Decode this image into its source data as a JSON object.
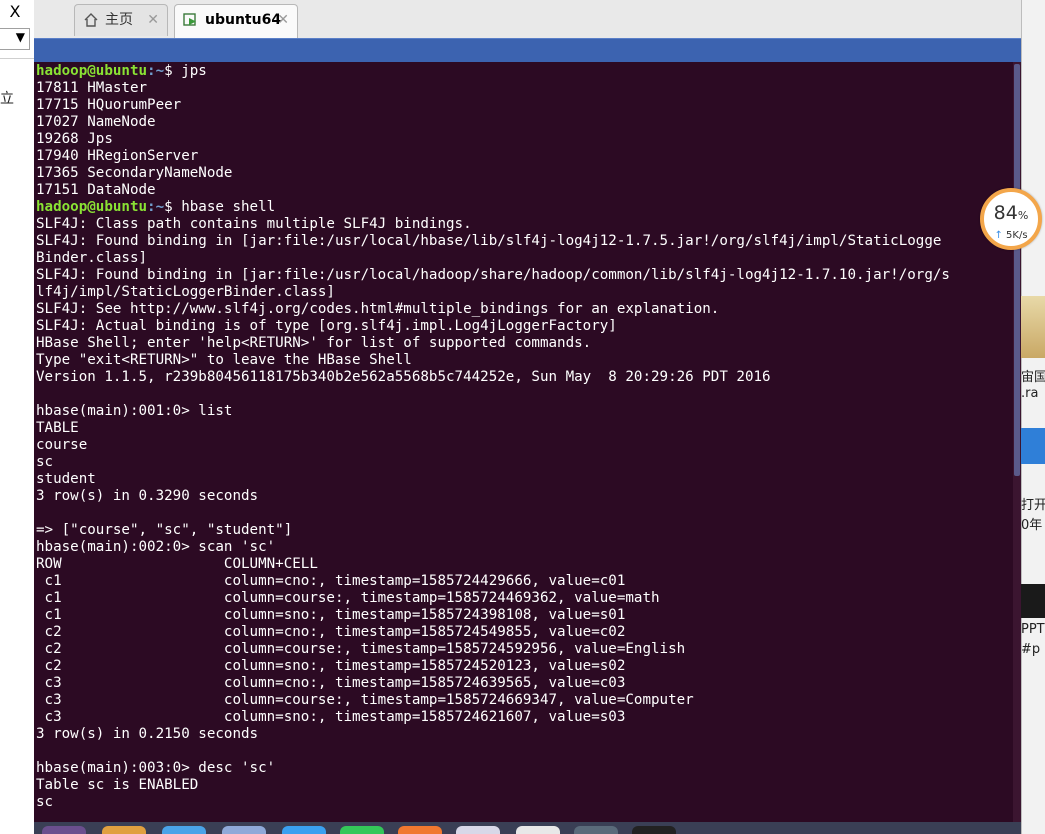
{
  "left_panel": {
    "close_glyph": "X",
    "dropdown_glyph": "▼",
    "partial_char": "立"
  },
  "tabs": [
    {
      "label": "主页",
      "close": "✕"
    },
    {
      "label": "ubuntu64",
      "close": "✕"
    }
  ],
  "terminal": {
    "prompt_user": "hadoop@ubuntu",
    "prompt_path": ":~",
    "lines": [
      {
        "prompt": true,
        "cmd": "$ jps"
      },
      {
        "text": "17811 HMaster"
      },
      {
        "text": "17715 HQuorumPeer"
      },
      {
        "text": "17027 NameNode"
      },
      {
        "text": "19268 Jps"
      },
      {
        "text": "17940 HRegionServer"
      },
      {
        "text": "17365 SecondaryNameNode"
      },
      {
        "text": "17151 DataNode"
      },
      {
        "prompt": true,
        "cmd": "$ hbase shell"
      },
      {
        "text": "SLF4J: Class path contains multiple SLF4J bindings."
      },
      {
        "text": "SLF4J: Found binding in [jar:file:/usr/local/hbase/lib/slf4j-log4j12-1.7.5.jar!/org/slf4j/impl/StaticLogge"
      },
      {
        "text": "Binder.class]"
      },
      {
        "text": "SLF4J: Found binding in [jar:file:/usr/local/hadoop/share/hadoop/common/lib/slf4j-log4j12-1.7.10.jar!/org/s"
      },
      {
        "text": "lf4j/impl/StaticLoggerBinder.class]"
      },
      {
        "text": "SLF4J: See http://www.slf4j.org/codes.html#multiple_bindings for an explanation."
      },
      {
        "text": "SLF4J: Actual binding is of type [org.slf4j.impl.Log4jLoggerFactory]"
      },
      {
        "text": "HBase Shell; enter 'help<RETURN>' for list of supported commands."
      },
      {
        "text": "Type \"exit<RETURN>\" to leave the HBase Shell"
      },
      {
        "text": "Version 1.1.5, r239b80456118175b340b2e562a5568b5c744252e, Sun May  8 20:29:26 PDT 2016"
      },
      {
        "text": ""
      },
      {
        "text": "hbase(main):001:0> list"
      },
      {
        "text": "TABLE"
      },
      {
        "text": "course"
      },
      {
        "text": "sc"
      },
      {
        "text": "student"
      },
      {
        "text": "3 row(s) in 0.3290 seconds"
      },
      {
        "text": ""
      },
      {
        "text": "=> [\"course\", \"sc\", \"student\"]"
      },
      {
        "text": "hbase(main):002:0> scan 'sc'"
      },
      {
        "text": "ROW                   COLUMN+CELL"
      },
      {
        "text": " c1                   column=cno:, timestamp=1585724429666, value=c01"
      },
      {
        "text": " c1                   column=course:, timestamp=1585724469362, value=math"
      },
      {
        "text": " c1                   column=sno:, timestamp=1585724398108, value=s01"
      },
      {
        "text": " c2                   column=cno:, timestamp=1585724549855, value=c02"
      },
      {
        "text": " c2                   column=course:, timestamp=1585724592956, value=English"
      },
      {
        "text": " c2                   column=sno:, timestamp=1585724520123, value=s02"
      },
      {
        "text": " c3                   column=cno:, timestamp=1585724639565, value=c03"
      },
      {
        "text": " c3                   column=course:, timestamp=1585724669347, value=Computer"
      },
      {
        "text": " c3                   column=sno:, timestamp=1585724621607, value=s03"
      },
      {
        "text": "3 row(s) in 0.2150 seconds"
      },
      {
        "text": ""
      },
      {
        "text": "hbase(main):003:0> desc 'sc'"
      },
      {
        "text": "Table sc is ENABLED"
      },
      {
        "text": "sc"
      }
    ]
  },
  "net_widget": {
    "percent": "84",
    "percent_sign": "%",
    "speed": "5K/s",
    "arrow": "↑"
  },
  "right_panel": {
    "texts": [
      "宙国",
      ".ra",
      "打开",
      "0年",
      "PPT",
      "#p"
    ]
  },
  "colors": {
    "terminal_bg": "#2c0a23",
    "prompt_user": "#8ae234",
    "prompt_path": "#729fcf",
    "vm_bar": "#3c63b0",
    "ring": "#f3a64a"
  }
}
